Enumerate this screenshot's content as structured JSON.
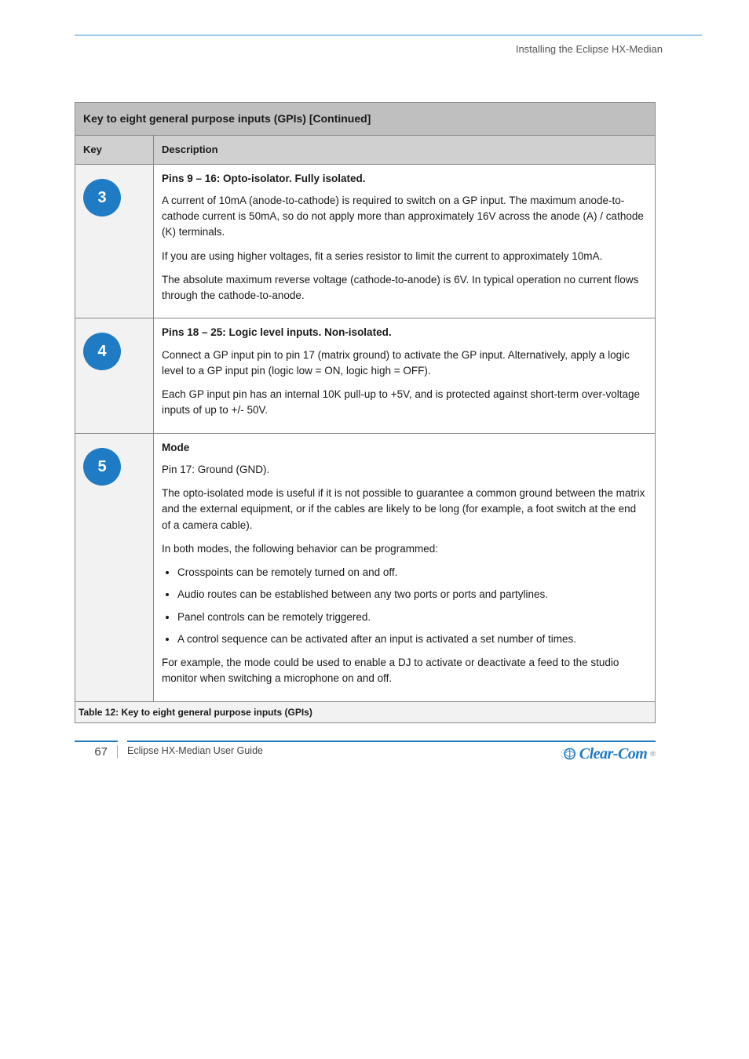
{
  "header": {
    "label": "Installing the Eclipse HX-Median"
  },
  "table": {
    "title": "Key to eight general purpose inputs (GPIs) [Continued]",
    "col_key": "Key",
    "col_desc": "Description",
    "rows": [
      {
        "num": "3",
        "title": "Pins 9 – 16: Opto-isolator. Fully isolated.",
        "body": "<p>A current of 10mA (anode-to-cathode) is required to switch on a GP input. The maximum anode-to-cathode current is 50mA, so do not apply more than approximately 16V across the anode (A) / cathode (K) terminals.</p><p>If you are using higher voltages, fit a series resistor to limit the current to approximately 10mA.</p><p>The absolute maximum reverse voltage (cathode-to-anode) is 6V. In typical operation no current flows through the cathode-to-anode.</p>"
      },
      {
        "num": "4",
        "title": "Pins 18 – 25: Logic level inputs. Non-isolated.",
        "body": "<p>Connect a GP input pin to pin 17 (matrix ground) to activate the GP input. Alternatively, apply a logic level to a GP input pin (logic low = ON, logic high = OFF).</p><p>Each GP input pin has an internal 10K pull-up to +5V, and is protected against short-term over-voltage inputs of up to +/- 50V.</p>"
      },
      {
        "num": "5",
        "title": "Mode",
        "body": "<p>Pin 17: Ground (GND).</p><p>The opto-isolated mode is useful if it is not possible to guarantee a common ground between the matrix and the external equipment, or if the cables are likely to be long (for example, a foot switch at the end of a camera cable).</p><p>In both modes, the following behavior can be programmed:</p><ul><li>Crosspoints can be remotely turned on and off.</li><li>Audio routes can be established between any two ports or ports and partylines.</li><li>Panel controls can be remotely triggered.</li><li>A control sequence can be activated after an input is activated a set number of times.</li></ul><p>For example, the mode could be used to enable a DJ to activate or deactivate a feed to the studio monitor when switching a microphone on and off.</p>"
      }
    ]
  },
  "note": "Table 12: Key to eight general purpose inputs (GPIs)",
  "footer": {
    "page": "67",
    "doc": "Eclipse HX-Median User Guide"
  },
  "logo": {
    "text": "Clear-Com"
  }
}
